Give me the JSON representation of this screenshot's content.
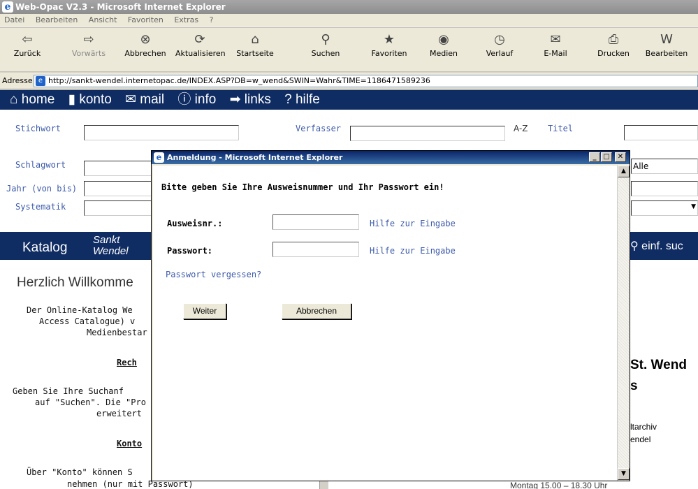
{
  "window": {
    "title": "Web-Opac V2.3 - Microsoft Internet Explorer",
    "menu": [
      "Datei",
      "Bearbeiten",
      "Ansicht",
      "Favoriten",
      "Extras",
      "?"
    ],
    "toolbar": [
      {
        "label": "Zurück",
        "icon": "⇦"
      },
      {
        "label": "Vorwärts",
        "icon": "⇨"
      },
      {
        "label": "Abbrechen",
        "icon": "⊗"
      },
      {
        "label": "Aktualisieren",
        "icon": "⟳"
      },
      {
        "label": "Startseite",
        "icon": "⌂"
      },
      {
        "label": "Suchen",
        "icon": "⚲"
      },
      {
        "label": "Favoriten",
        "icon": "★"
      },
      {
        "label": "Medien",
        "icon": "◉"
      },
      {
        "label": "Verlauf",
        "icon": "◷"
      },
      {
        "label": "E-Mail",
        "icon": "✉"
      },
      {
        "label": "Drucken",
        "icon": "⎙"
      },
      {
        "label": "Bearbeiten",
        "icon": "W"
      }
    ],
    "address_label": "Adresse",
    "address_url": "http://sankt-wendel.internetopac.de/INDEX.ASP?DB=w_wend&SWIN=Wahr&TIME=1186471589236"
  },
  "nav": [
    "⌂ home",
    "▮ konto",
    "✉ mail",
    "ⓘ info",
    "➡ links",
    "? hilfe"
  ],
  "search": {
    "stichwort": "Stichwort",
    "verfasser": "Verfasser",
    "titel": "Titel",
    "schlagwort": "Schlagwort",
    "jahr": "Jahr (von bis)",
    "systematik": "Systematik",
    "az": "A-Z",
    "select_value": "Alle"
  },
  "catbar": {
    "katalog": "Katalog",
    "sankt": "Sankt",
    "wendel": "Wendel",
    "einf": "⚲ einf. suc"
  },
  "left": {
    "welcome": "Herzlich Willkomme",
    "p1a": "Der Online-Katalog We",
    "p1b": "Access Catalogue) v",
    "p1c": "Medienbestar",
    "h1": "Rech",
    "p2a": "Geben Sie Ihre Suchanf",
    "p2b": "auf \"Suchen\". Die \"Pro",
    "p2c": "erweitert",
    "h2": "Konto",
    "p3a": "Über \"Konto\" können S",
    "p3b": "nehmen (nur mit Passwort)"
  },
  "right": {
    "title": "St. Wend",
    "sub": "s",
    "line1": "ltarchiv",
    "line2": "endel",
    "hours": "Montag 15.00 – 18.30 Uhr"
  },
  "dialog": {
    "title": "Anmeldung - Microsoft Internet Explorer",
    "heading": "Bitte geben Sie Ihre Ausweisnummer und Ihr Passwort ein!",
    "ausweis_label": "Ausweisnr.:",
    "passwort_label": "Passwort:",
    "hilfe": "Hilfe zur Eingabe",
    "forgot": "Passwort vergessen?",
    "weiter": "Weiter",
    "abbrechen": "Abbrechen",
    "ausweis_value": "",
    "passwort_value": ""
  }
}
